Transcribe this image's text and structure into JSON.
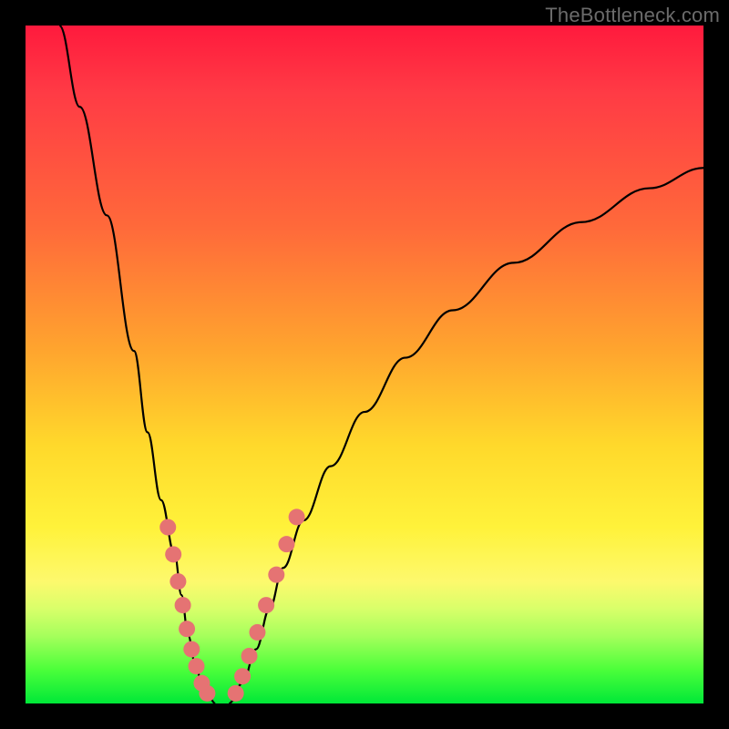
{
  "watermark": "TheBottleneck.com",
  "chart_data": {
    "type": "line",
    "title": "",
    "xlabel": "",
    "ylabel": "",
    "xlim": [
      0,
      100
    ],
    "ylim": [
      0,
      100
    ],
    "curve_left": {
      "name": "descending-branch",
      "x": [
        5,
        8,
        12,
        16,
        18,
        20,
        22,
        23,
        24,
        25,
        26,
        27,
        28
      ],
      "y": [
        100,
        88,
        72,
        52,
        40,
        30,
        22,
        16,
        10,
        6,
        3,
        1,
        0
      ]
    },
    "curve_right": {
      "name": "ascending-branch",
      "x": [
        30,
        32,
        34,
        36,
        38,
        41,
        45,
        50,
        56,
        63,
        72,
        82,
        92,
        100
      ],
      "y": [
        0,
        3,
        8,
        14,
        20,
        27,
        35,
        43,
        51,
        58,
        65,
        71,
        76,
        79
      ]
    },
    "dots_left": {
      "name": "dots-descending-branch",
      "x": [
        21.0,
        21.8,
        22.5,
        23.2,
        23.8,
        24.5,
        25.2,
        26.0,
        26.8
      ],
      "y": [
        26.0,
        22.0,
        18.0,
        14.5,
        11.0,
        8.0,
        5.5,
        3.0,
        1.5
      ]
    },
    "dots_right": {
      "name": "dots-ascending-branch",
      "x": [
        31.0,
        32.0,
        33.0,
        34.2,
        35.5,
        37.0,
        38.5,
        40.0
      ],
      "y": [
        1.5,
        4.0,
        7.0,
        10.5,
        14.5,
        19.0,
        23.5,
        27.5
      ]
    },
    "min_point": {
      "x": 29,
      "y": 0
    },
    "gradient_note": "background color top=red→bottom=green encodes y-value magnitude"
  }
}
